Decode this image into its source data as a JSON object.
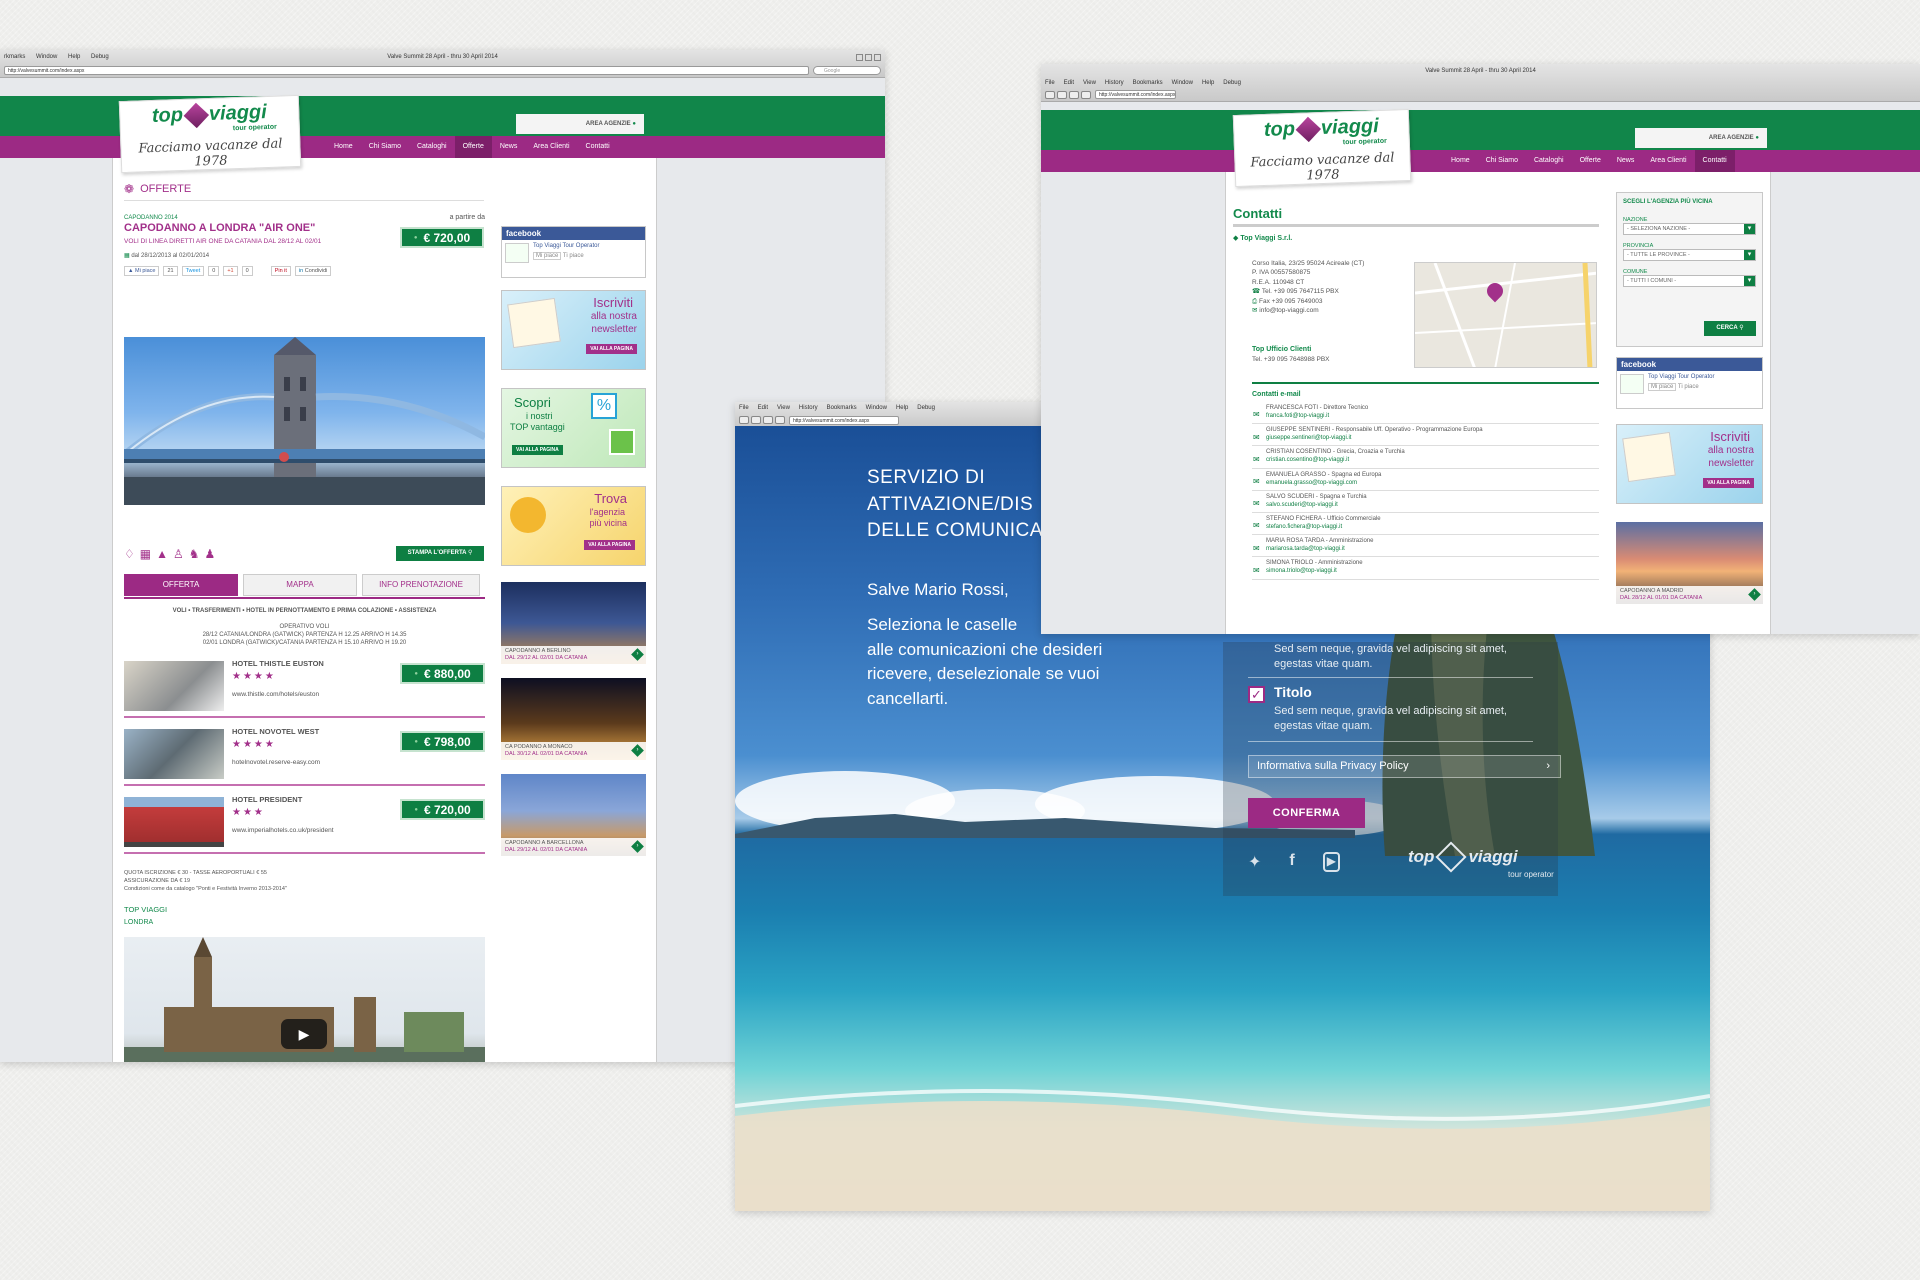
{
  "left": {
    "window_title": "Valve Summit 28 April - thru 30 April 2014",
    "menu": [
      "rkmarks",
      "Window",
      "Help",
      "Debug"
    ],
    "url": "http://valvesummit.com/index.aspx",
    "search_placeholder": "Google",
    "area_label": "AREA AGENZIE",
    "logo": {
      "top": "top",
      "viaggi": "viaggi",
      "tour": "tour operator",
      "tagline": "Facciamo vacanze dal 1978"
    },
    "nav": [
      "Home",
      "Chi Siamo",
      "Cataloghi",
      "Offerte",
      "News",
      "Area Clienti",
      "Contatti"
    ],
    "active_nav": "Offerte",
    "section_title": "OFFERTE",
    "offer": {
      "kicker": "CAPODANNO 2014",
      "title": "CAPODANNO A LONDRA \"AIR ONE\"",
      "subtitle": "VOLI DI LINEA DIRETTI AIR ONE DA CATANIA DAL 28/12 AL 02/01",
      "from_label": "a partire da",
      "price": "€ 720,00",
      "dates": "dal 28/12/2013 al 02/01/2014",
      "social": [
        "Mi piace",
        "21",
        "Tweet",
        "0",
        "+1",
        "0",
        "Pin it",
        "Condividi"
      ],
      "print_label": "STAMPA L'OFFERTA",
      "tabs": [
        "OFFERTA",
        "MAPPA",
        "INFO PRENOTAZIONE"
      ],
      "includes": "VOLI • TRASFERIMENTI • HOTEL IN PERNOTTAMENTO E PRIMA COLAZIONE • ASSISTENZA",
      "operativo_title": "OPERATIVO VOLI",
      "operativo_1": "28/12 CATANIA/LONDRA (GATWICK) PARTENZA H 12.25 ARRIVO H 14.35",
      "operativo_2": "02/01 LONDRA (GATWICK)/CATANIA PARTENZA H 15.10 ARRIVO H 19.20"
    },
    "hotels": [
      {
        "name": "HOTEL THISTLE EUSTON",
        "stars": "★★★★",
        "url": "www.thistle.com/hotels/euston",
        "price": "€ 880,00"
      },
      {
        "name": "HOTEL NOVOTEL WEST",
        "stars": "★★★★",
        "url": "hotelnovotel.reserve-easy.com",
        "price": "€ 798,00"
      },
      {
        "name": "HOTEL PRESIDENT",
        "stars": "★★★",
        "url": "www.imperialhotels.co.uk/president",
        "price": "€ 720,00"
      }
    ],
    "fees_1": "QUOTA ISCRIZIONE € 30 - TASSE AEROPORTUALI € 55",
    "fees_2": "ASSICURAZIONE DA € 19",
    "fees_3": "Condizioni come da catalogo \"Ponti e Festività Inverno 2013-2014\"",
    "tag_1": "TOP VIAGGI",
    "tag_2": "LONDRA",
    "facebook": {
      "header": "facebook",
      "page": "Top Viaggi Tour Operator",
      "like": "Mi piace",
      "count": "Ti piace"
    },
    "promo_newsletter": {
      "line1": "Iscriviti",
      "line2": "alla nostra",
      "line3": "newsletter",
      "btn": "VAI ALLA PAGINA"
    },
    "promo_vantaggi": {
      "line1": "Scopri",
      "line2": "i nostri",
      "line3": "TOP vantaggi",
      "btn": "VAI ALLA PAGINA"
    },
    "promo_agenzia": {
      "line1": "Trova",
      "line2": "l'agenzia",
      "line3": "più vicina",
      "btn": "VAI ALLA PAGINA"
    },
    "destinations": [
      {
        "title": "CAPODANNO A BERLINO",
        "dates": "DAL 29/12 AL 02/01 DA CATANIA"
      },
      {
        "title": "CA PODANNO A MONACO",
        "dates": "DAL 30/12 AL 02/01 DA CATANIA"
      },
      {
        "title": "CAPODANNO A BARCELLONA",
        "dates": "DAL 29/12 AL 02/01 DA CATANIA"
      }
    ]
  },
  "right": {
    "window_title": "Valve Summit 28 April - thru 30 April 2014",
    "menu": [
      "File",
      "Edit",
      "View",
      "History",
      "Bookmarks",
      "Window",
      "Help",
      "Debug"
    ],
    "url": "http://valvesummit.com/index.aspx",
    "area_label": "AREA AGENZIE",
    "logo": {
      "top": "top",
      "viaggi": "viaggi",
      "tour": "tour operator",
      "tagline": "Facciamo vacanze dal 1978"
    },
    "nav": [
      "Home",
      "Chi Siamo",
      "Cataloghi",
      "Offerte",
      "News",
      "Area Clienti",
      "Contatti"
    ],
    "active_nav": "Contatti",
    "title": "Contatti",
    "company": "Top Viaggi S.r.l.",
    "address": [
      "Corso Italia, 23/25 95024 Acireale (CT)",
      "P. IVA 00557580875",
      "R.E.A. 110948 CT"
    ],
    "tel": "Tel. +39 095 7647115 PBX",
    "fax": "Fax +39 095 7649003",
    "email": "info@top-viaggi.com",
    "ufficio_title": "Top Ufficio Clienti",
    "ufficio_tel": "Tel. +39 095 7648988 PBX",
    "emails_title": "Contatti e-mail",
    "contacts": [
      {
        "name": "FRANCESCA FOTI - Direttore Tecnico",
        "mail": "franca.foti@top-viaggi.it"
      },
      {
        "name": "GIUSEPPE SENTINERI - Responsabile Uff. Operativo - Programmazione Europa",
        "mail": "giuseppe.sentineri@top-viaggi.it"
      },
      {
        "name": "CRISTIAN COSENTINO - Grecia, Croazia e Turchia",
        "mail": "cristian.cosentino@top-viaggi.it"
      },
      {
        "name": "EMANUELA GRASSO - Spagna ed Europa",
        "mail": "emanuela.grasso@top-viaggi.com"
      },
      {
        "name": "SALVO SCUDERI - Spagna e Turchia",
        "mail": "salvo.scuderi@top-viaggi.it"
      },
      {
        "name": "STEFANO FICHERA - Ufficio Commerciale",
        "mail": "stefano.fichera@top-viaggi.it"
      },
      {
        "name": "MARIA ROSA TARDA - Amministrazione",
        "mail": "mariarosa.tarda@top-viaggi.it"
      },
      {
        "name": "SIMONA TRIOLO - Amministrazione",
        "mail": "simona.triolo@top-viaggi.it"
      }
    ],
    "finder": {
      "title": "SCEGLI L'AGENZIA PIÙ VICINA",
      "nazione_label": "NAZIONE",
      "nazione": "- SELEZIONA NAZIONE -",
      "provincia_label": "PROVINCIA",
      "provincia": "- TUTTE LE PROVINCE -",
      "comune_label": "COMUNE",
      "comune": "- TUTTI I COMUNI -",
      "btn": "CERCA"
    },
    "facebook": {
      "header": "facebook",
      "page": "Top Viaggi Tour Operator",
      "like": "Mi piace",
      "count": "Ti piace"
    },
    "promo_newsletter": {
      "line1": "Iscriviti",
      "line2": "alla nostra",
      "line3": "newsletter",
      "btn": "VAI ALLA PAGINA"
    },
    "destination": {
      "title": "CAPODANNO A MADRID",
      "dates": "DAL 28/12 AL 01/01 DA CATANIA"
    }
  },
  "front": {
    "menu": [
      "File",
      "Edit",
      "View",
      "History",
      "Bookmarks",
      "Window",
      "Help",
      "Debug"
    ],
    "url": "http://valvesummit.com/index.aspx",
    "heading_1": "SERVIZIO DI",
    "heading_2": "ATTIVAZIONE/DIS",
    "heading_3": "DELLE COMUNICA",
    "greeting": "Salve Mario Rossi,",
    "intro_1": "Seleziona le caselle",
    "intro_2": "alle comunicazioni che desideri",
    "intro_3": "ricevere, deselezionale se vuoi",
    "intro_4": "cancellarti.",
    "option_prev_text_1": "Sed sem neque, gravida vel adipiscing sit amet,",
    "option_prev_text_2": "egestas vitae quam.",
    "option_title": "Titolo",
    "option_text_1": "Sed sem neque, gravida vel adipiscing sit amet,",
    "option_text_2": "egestas vitae quam.",
    "privacy": "Informativa sulla Privacy Policy",
    "confirm": "CONFERMA",
    "logo_top": "top",
    "logo_viaggi": "viaggi",
    "logo_tour": "tour operator",
    "social_icons": [
      "twitter-icon",
      "facebook-icon",
      "youtube-icon"
    ]
  },
  "colors": {
    "green": "#11864a",
    "magenta": "#9c2a84",
    "price_green": "#0e7f43",
    "facebook": "#3b5998"
  }
}
